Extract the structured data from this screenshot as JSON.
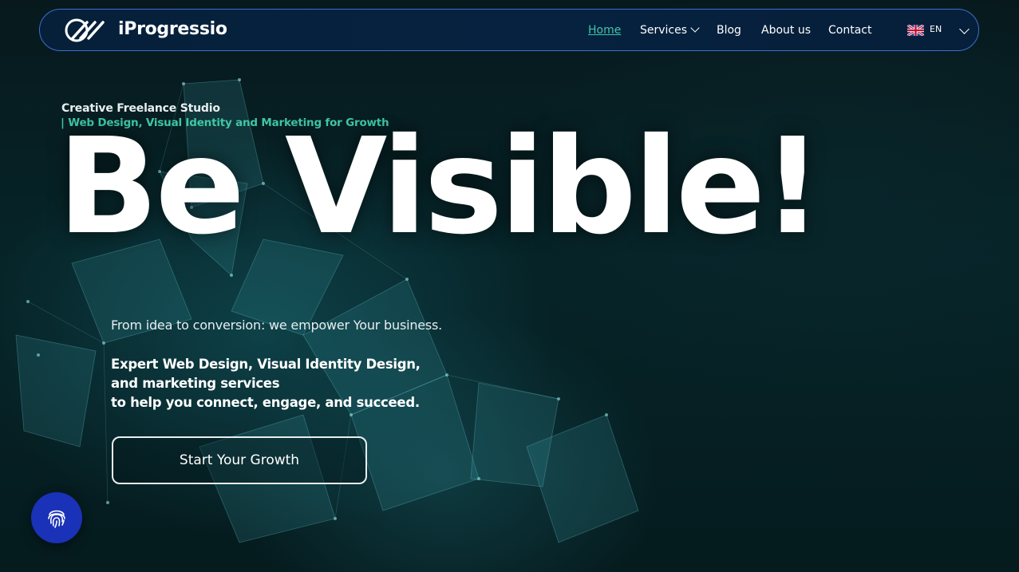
{
  "brand": {
    "name": "iProgressio",
    "logo_icon": "stripes-logo-icon"
  },
  "nav": {
    "items": [
      {
        "label": "Home",
        "active": true
      },
      {
        "label": "Services",
        "dropdown": true
      },
      {
        "label": "Blog"
      },
      {
        "label": "About us"
      },
      {
        "label": "Contact"
      }
    ],
    "language": {
      "code": "EN",
      "flag_icon": "uk-flag-icon",
      "dropdown_icon": "chevron-down-icon"
    }
  },
  "hero": {
    "eyebrow": "Creative Freelance Studio",
    "eyebrow_sub": "| Web Design, Visual Identity and Marketing for Growth",
    "headline": "Be Visible!",
    "lead": "From idea to conversion: we empower Your business.",
    "description_lines": [
      "Expert Web Design, Visual Identity Design,",
      "and marketing services",
      "to help you connect, engage, and succeed."
    ],
    "cta_label": "Start Your Growth"
  },
  "floating_button": {
    "icon": "fingerprint-icon"
  },
  "colors": {
    "accent": "#3fc6a6",
    "nav_border": "#3b6fd1",
    "fingerprint_bg": "#1a32b8",
    "background": "#061a1e"
  }
}
